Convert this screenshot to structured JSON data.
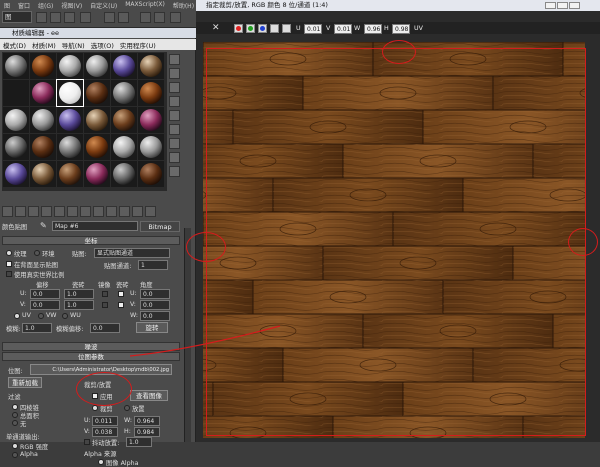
{
  "app": {
    "menu": [
      "图",
      "窗口",
      "组(G)",
      "视图(V)",
      "自定义(U)",
      "MAXScript(X)",
      "帮助(H)"
    ],
    "dropdown": "图"
  },
  "material_editor": {
    "title": "材质编辑器 - ee",
    "menu": [
      "模式(D)",
      "材质(M)",
      "导航(N)",
      "选项(O)",
      "实用程序(U)"
    ],
    "map_label": "颜色贴图",
    "map_name": "Map #6",
    "map_type": "Bitmap",
    "coords": {
      "header": "坐标",
      "radio_texture": "纹理",
      "radio_env": "环境",
      "map_label": "贴图:",
      "map_channel": "显式贴图通道",
      "show_on_back": "在背面显示贴图",
      "real_world": "使用真实世界比例",
      "map_channel_label": "贴图通道:",
      "map_channel_val": "1",
      "offset": "偏移",
      "tiling": "瓷砖",
      "mirror": "镜像",
      "tile": "瓷砖",
      "angle": "角度",
      "u": "U:",
      "v": "V:",
      "w": "W:",
      "u_offset": "0.0",
      "v_offset": "0.0",
      "u_tiling": "1.0",
      "v_tiling": "1.0",
      "u_angle": "0.0",
      "v_angle": "0.0",
      "w_angle": "0.0",
      "uv": "UV",
      "vw": "VW",
      "wu": "WU",
      "blur_label": "模糊:",
      "blur_val": "1.0",
      "blur_offset_label": "模糊偏移:",
      "blur_offset_val": "0.0",
      "rotate": "旋转"
    },
    "noise_header": "噪波",
    "bitmap_params": {
      "header": "位图参数",
      "bitmap_label": "位图:",
      "bitmap_path": "C:\\Users\\Administrator\\Desktop\\mdb\\002.jpg",
      "reload": "重新加载",
      "crop_header": "裁剪/放置",
      "apply": "应用",
      "view_image": "查看图像",
      "crop": "裁剪",
      "place": "放置",
      "filter_header": "过滤",
      "four_point": "四棱锥",
      "summed": "总面积",
      "none": "无",
      "u_label": "U:",
      "v_label": "V:",
      "w_label": "W:",
      "h_label": "H:",
      "u_val": "0.011",
      "v_val": "0.038",
      "w_val": "0.964",
      "h_val": "0.984",
      "jitter": "抖动放置:",
      "jitter_val": "1.0",
      "mono_output": "单通道输出:",
      "rgb_intensity": "RGB 强度",
      "alpha": "Alpha",
      "alpha_source": "Alpha 来源",
      "image_alpha": "图像 Alpha"
    }
  },
  "bitmap_window": {
    "title": "指定裁剪/放置, RGB 颜色 8 位/通道 (1:4)",
    "toolbar": {
      "u": "U",
      "u_val": "0.01",
      "v": "V",
      "v_val": "0.01",
      "w": "W",
      "w_val": "0.96",
      "h": "H",
      "h_val": "0.98",
      "uv": "UV"
    },
    "colors": {
      "red": "#e02020",
      "green": "#20a020",
      "blue": "#2040d0"
    }
  }
}
